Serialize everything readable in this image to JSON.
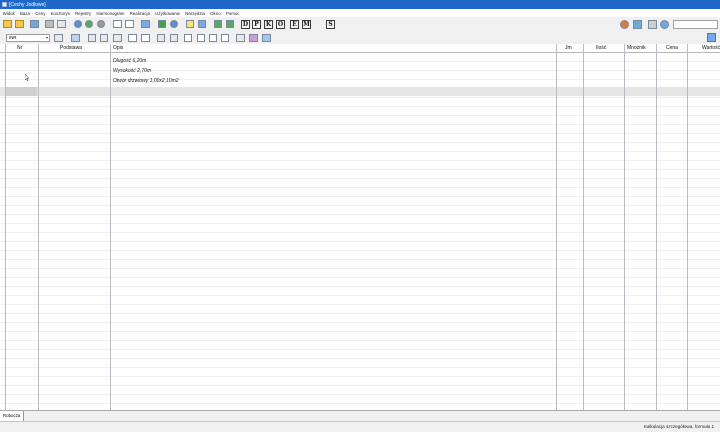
{
  "window": {
    "title": "[Cechy Jodlowe]"
  },
  "menu": [
    "Widok",
    "Baza",
    "Ceny",
    "Kosztorys",
    "Rejestry",
    "Harmonogram",
    "Realizacja",
    "Użytkowanie",
    "Narzędzia",
    "Okno",
    "Pomoc"
  ],
  "toolbar": {
    "unit_combo": "INR",
    "letter_buttons": [
      "D",
      "P",
      "K",
      "O",
      "E",
      "M",
      "S"
    ]
  },
  "table": {
    "columns": [
      "Nr",
      "Podstawa",
      "Opis",
      "Jm",
      "Ilość",
      "Mnożnik",
      "Cena",
      "Wartość"
    ],
    "rows": [
      {
        "opis": "Długość 6,20m"
      },
      {
        "opis": "Wysokość 2,70m"
      },
      {
        "opis": "Otwór drzwiowy 1,00x2,10m2"
      }
    ]
  },
  "tabs": [
    "Robocza"
  ],
  "status": {
    "text": "Kalkulacja szczegółowa, formuła 1"
  },
  "colors": {
    "titlebar": "#1f68c9",
    "grid_line": "#d8dde3",
    "selected_row": "#e6e6e6"
  }
}
